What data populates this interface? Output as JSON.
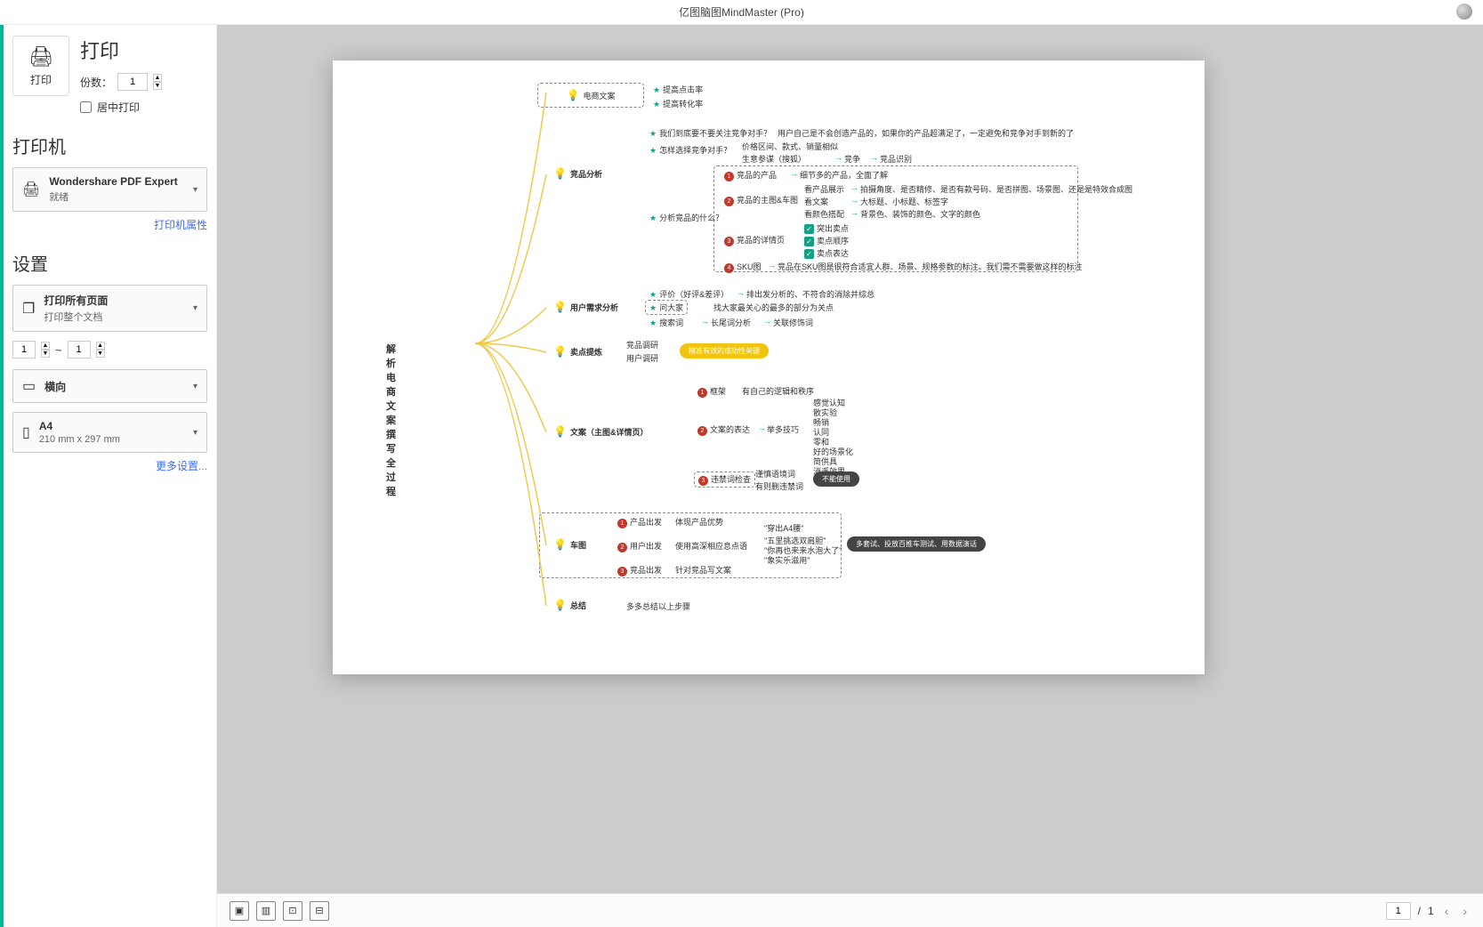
{
  "app": {
    "title": "亿图脑图MindMaster (Pro)"
  },
  "sidebar": {
    "print_title": "打印",
    "print_button": "打印",
    "copies_label": "份数：",
    "copies_value": "1",
    "center_print": "居中打印",
    "printer_section": "打印机",
    "printer_name": "Wondershare PDF Expert",
    "printer_status": "就绪",
    "printer_props_link": "打印机属性",
    "settings_section": "设置",
    "pages_main": "打印所有页面",
    "pages_sub": "打印整个文档",
    "range_from": "1",
    "range_sep": "~",
    "range_to": "1",
    "orientation": "横向",
    "paper_size": "A4",
    "paper_dims": "210 mm x 297 mm",
    "more_settings": "更多设置..."
  },
  "pager": {
    "current": "1",
    "sep": "/",
    "total": "1"
  },
  "mindmap": {
    "root": "解析电商文案撰写全过程",
    "b1": {
      "title": "电商文案",
      "c1": "提高点击率",
      "c2": "提高转化率"
    },
    "b2": {
      "title": "竞品分析",
      "q1": "我们到底要不要关注竞争对手？",
      "q1a": "用户自己是不会创造产品的，如果你的产品超满足了，一定避免和竞争对手到新的了",
      "q2": "怎样选择竞争对手？",
      "q2a": "价格区间、款式、销量相似",
      "q2b": "生意参谋（搜狐）",
      "q2b1": "竞争",
      "q2b2": "竞品识别",
      "q3": "分析竞品的什么？",
      "p1": "竞品的产品",
      "p1a": "细节多的产品，全面了解",
      "p2": "竞品的主图&车图",
      "p2l1": "看产品展示",
      "p2l1a": "拍摄角度、是否精修、是否有款号码、是否拼图、场景图、还是是特效合成图",
      "p2l2": "看文案",
      "p2l2a": "大标题、小标题、标签字",
      "p2l3": "看颜色搭配",
      "p2l3a": "背景色、装饰的颜色、文字的颜色",
      "p3": "竞品的详情页",
      "p3a": "突出卖点",
      "p3b": "卖点顺序",
      "p3c": "卖点表达",
      "p4": "SKU图",
      "p4a": "竞品在SKU图是很符合适宜人群、场景、规格参数的标注。我们需不需要做这样的标注"
    },
    "b3": {
      "title": "用户需求分析",
      "r1": "评价（好评&差评）",
      "r1a": "排出发分析的、不符合的消除并综总",
      "r2": "问大家",
      "r2a": "找大家最关心的最多的部分为关点",
      "r3": "搜索词",
      "r3a": "长尾词分析",
      "r3b": "关联修饰词"
    },
    "b4": {
      "title": "卖点提炼",
      "r1": "竞品调研",
      "r2": "用户调研",
      "pill": "精准有效的成功性关键"
    },
    "b5": {
      "title": "文案（主图&详情页）",
      "r1": "框架",
      "r1a": "有自己的逻辑和秩序",
      "r2": "文案的表达",
      "r2a": "举多技巧",
      "tips": [
        "感觉认知",
        "散实验",
        "畅销",
        "认同",
        "零和",
        "好的场景化",
        "简供具",
        "消遥效果"
      ],
      "r3": "违禁词检查",
      "r3a": "谨慎语境词",
      "r3b": "有则删违禁词",
      "pill_dark": "不能使用"
    },
    "b6": {
      "title": "车图",
      "r1": "产品出发",
      "r1a": "体现产品优势",
      "r2": "用户出发",
      "r2a": "使用高深相应息点语",
      "tips": [
        "\"穿出A4腰\"",
        "\"五里挑选双肩胆\"",
        "\"你再也来来水泡大了\"",
        "\"象实乐滋用\""
      ],
      "pill": "多套试、投放百推车测试、用数据演话",
      "r3": "竞品出发",
      "r3a": "针对竞品写文案"
    },
    "b7": {
      "title": "总结",
      "r1": "多多总结以上步骤"
    }
  }
}
